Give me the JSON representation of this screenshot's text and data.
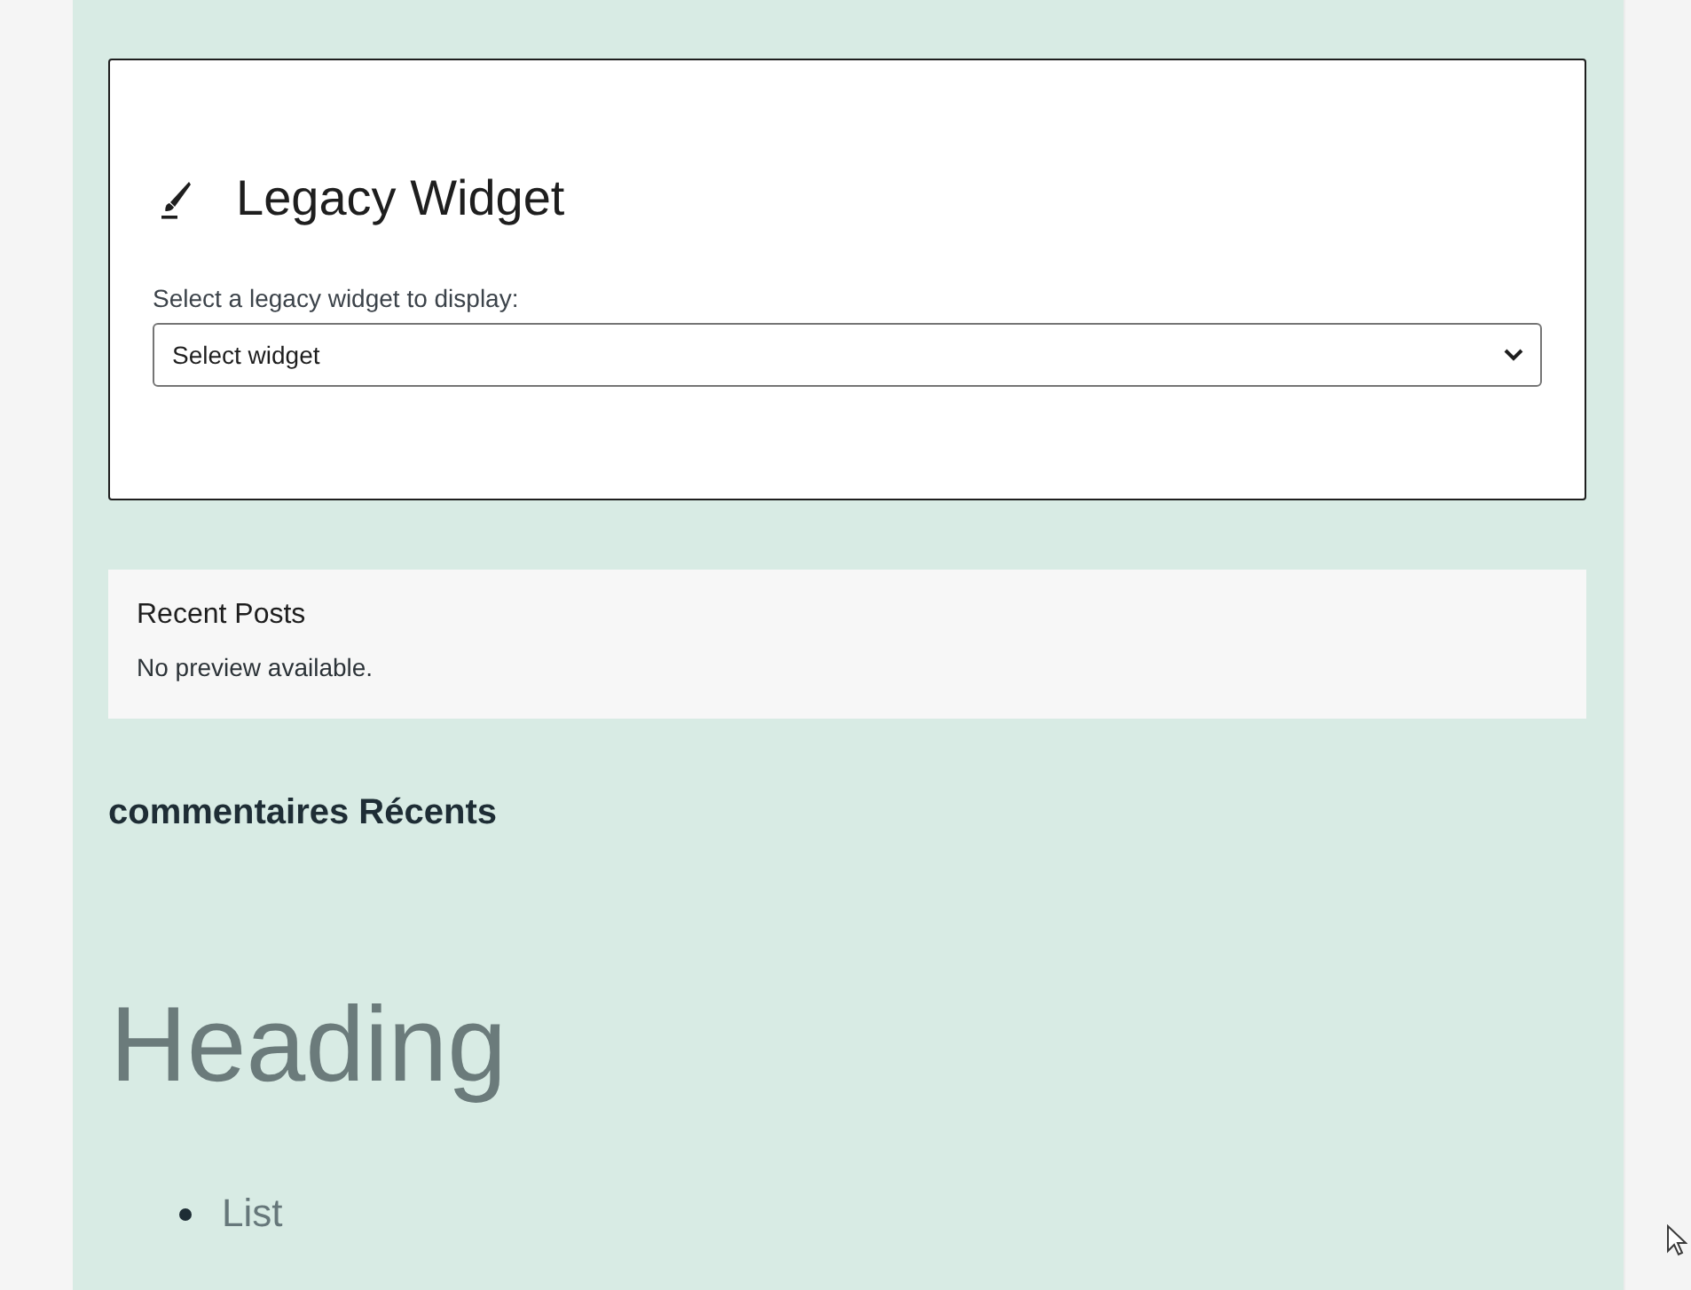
{
  "widget_block": {
    "title": "Legacy Widget",
    "label": "Select a legacy widget to display:",
    "select": {
      "value": "Select widget"
    }
  },
  "preview_block": {
    "title": "Recent Posts",
    "message": "No preview available."
  },
  "section_heading": "commentaires Récents",
  "heading": "Heading",
  "list_items": [
    "List"
  ]
}
